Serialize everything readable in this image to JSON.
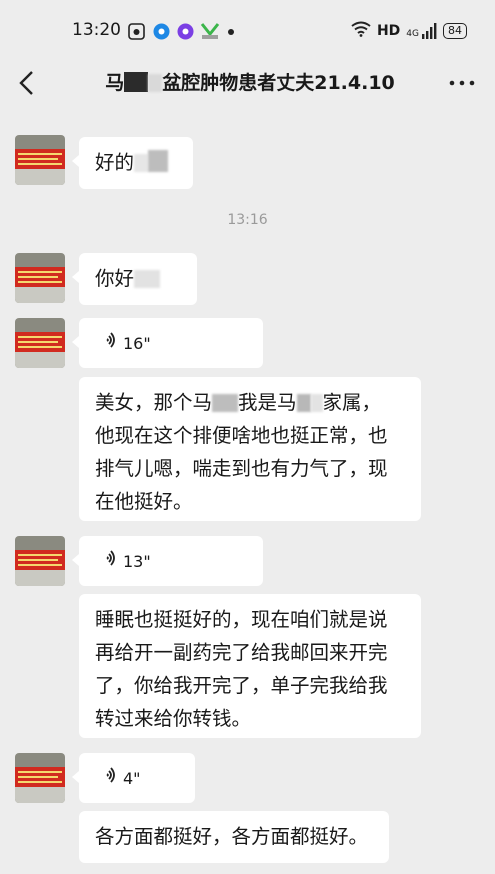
{
  "status_bar": {
    "time": "13:20",
    "network_label": "HD",
    "signal_label": "4G",
    "battery": "84",
    "icons": [
      "camera-app-icon",
      "blue-app-icon",
      "purple-app-icon",
      "green-app-icon",
      "notification-dot-icon",
      "wifi-icon",
      "signal-icon",
      "battery-icon"
    ]
  },
  "header": {
    "title_prefix": "马",
    "title_part2": "盆腔肿物患者丈夫21.4.10"
  },
  "timestamp": "13:16",
  "messages": [
    {
      "type": "text",
      "text": "好的"
    },
    {
      "type": "text",
      "text": "你好"
    },
    {
      "type": "voice",
      "duration": "16\""
    },
    {
      "type": "text",
      "text": "美女，那个马",
      "lines": [
        "美女，那个马  我是马    家属，",
        "他现在这个排便啥地也挺正常，也",
        "排气儿嗯，喘走到也有力气了，现",
        "在他挺好。"
      ]
    },
    {
      "type": "voice",
      "duration": "13\""
    },
    {
      "type": "text",
      "lines": [
        "睡眠也挺挺好的，现在咱们就是说",
        "再给开一副药完了给我邮回来开完",
        "了，你给我开完了，单子完我给我",
        "转过来给你转钱。"
      ]
    },
    {
      "type": "voice",
      "duration": "4\""
    },
    {
      "type": "text",
      "text": "各方面都挺好，各方面都挺好。"
    }
  ]
}
